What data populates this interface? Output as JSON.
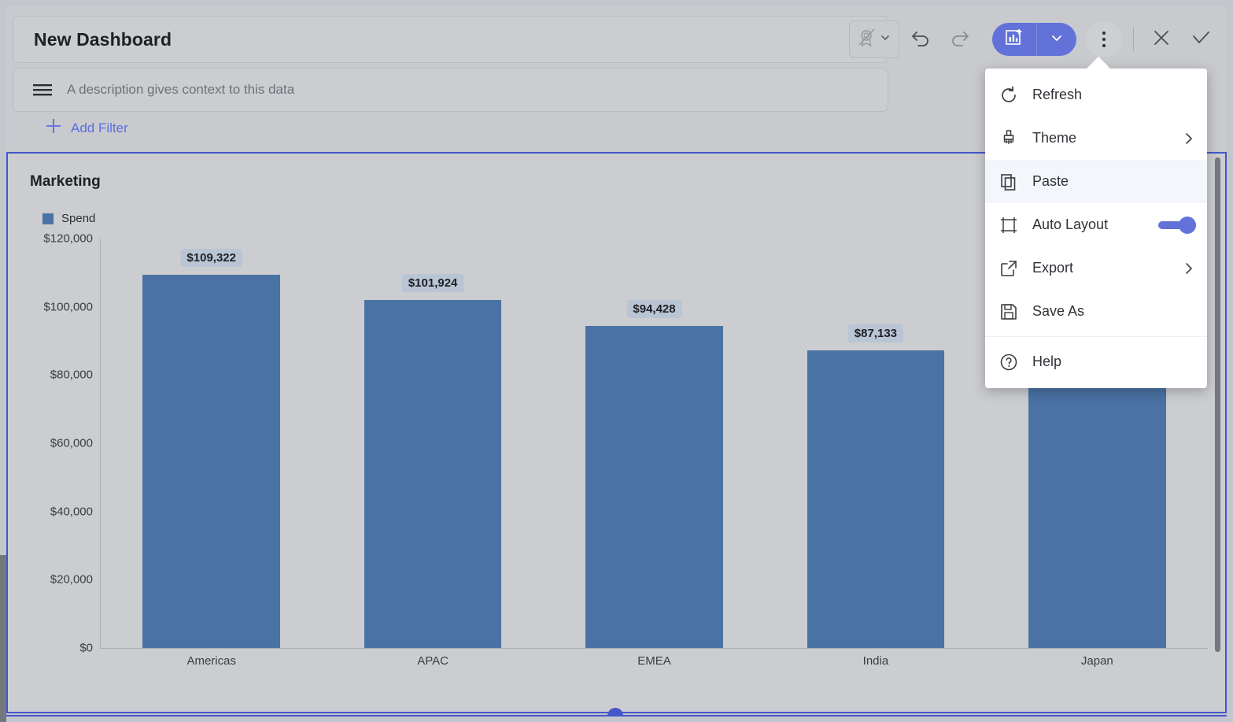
{
  "header": {
    "title": "New Dashboard",
    "description_placeholder": "A description gives context to this data",
    "description_value": "",
    "add_filter_label": "Add Filter",
    "description_icon": "lines-list-icon",
    "plus_icon": "plus-icon"
  },
  "toolbar": {
    "certification_icon": "not-certified-badge-icon",
    "certification_caret_icon": "chevron-down-icon",
    "undo_icon": "undo-icon",
    "redo_icon": "redo-icon",
    "add_chart_icon": "add-chart-icon",
    "add_chart_caret_icon": "chevron-down-icon",
    "more_icon": "kebab-menu-icon",
    "close_icon": "close-x-icon",
    "confirm_icon": "checkmark-icon",
    "accent_color": "#6272d8"
  },
  "menu": {
    "items": [
      {
        "label": "Refresh",
        "icon": "refresh-icon",
        "has_submenu": false,
        "has_toggle": false,
        "active": false
      },
      {
        "label": "Theme",
        "icon": "paintbrush-icon",
        "has_submenu": true,
        "has_toggle": false,
        "active": false
      },
      {
        "label": "Paste",
        "icon": "paste-copy-icon",
        "has_submenu": false,
        "has_toggle": false,
        "active": true
      },
      {
        "label": "Auto Layout",
        "icon": "auto-layout-icon",
        "has_submenu": false,
        "has_toggle": true,
        "active": false,
        "toggle_on": true
      },
      {
        "label": "Export",
        "icon": "external-link-icon",
        "has_submenu": true,
        "has_toggle": false,
        "active": false
      },
      {
        "label": "Save As",
        "icon": "save-floppy-icon",
        "has_submenu": false,
        "has_toggle": false,
        "active": false
      },
      {
        "label": "Help",
        "icon": "help-circle-icon",
        "has_submenu": false,
        "has_toggle": false,
        "active": false,
        "separator_before": true
      }
    ],
    "submenu_icon": "chevron-right-icon"
  },
  "panel": {
    "title": "Marketing",
    "selected_border_color": "#4557c9"
  },
  "chart_data": {
    "type": "bar",
    "title": "Marketing",
    "categories": [
      "Americas",
      "APAC",
      "EMEA",
      "India",
      "Japan"
    ],
    "values": [
      109322,
      101924,
      94428,
      87133,
      81000
    ],
    "value_labels": [
      "$109,322",
      "$101,924",
      "$94,428",
      "$87,133",
      ""
    ],
    "series": [
      {
        "name": "Spend",
        "values": [
          109322,
          101924,
          94428,
          87133,
          81000
        ],
        "color": "#4a72a4"
      }
    ],
    "legend": [
      "Spend"
    ],
    "legend_position": "top-left",
    "xlabel": "",
    "ylabel": "",
    "ylim": [
      0,
      120000
    ],
    "yticks": [
      0,
      20000,
      40000,
      60000,
      80000,
      100000,
      120000
    ],
    "ytick_labels": [
      "$0",
      "$20,000",
      "$40,000",
      "$60,000",
      "$80,000",
      "$100,000",
      "$120,000"
    ],
    "grid": false,
    "note": "Japan bar is partially occluded by the open menu; its value label is hidden."
  }
}
